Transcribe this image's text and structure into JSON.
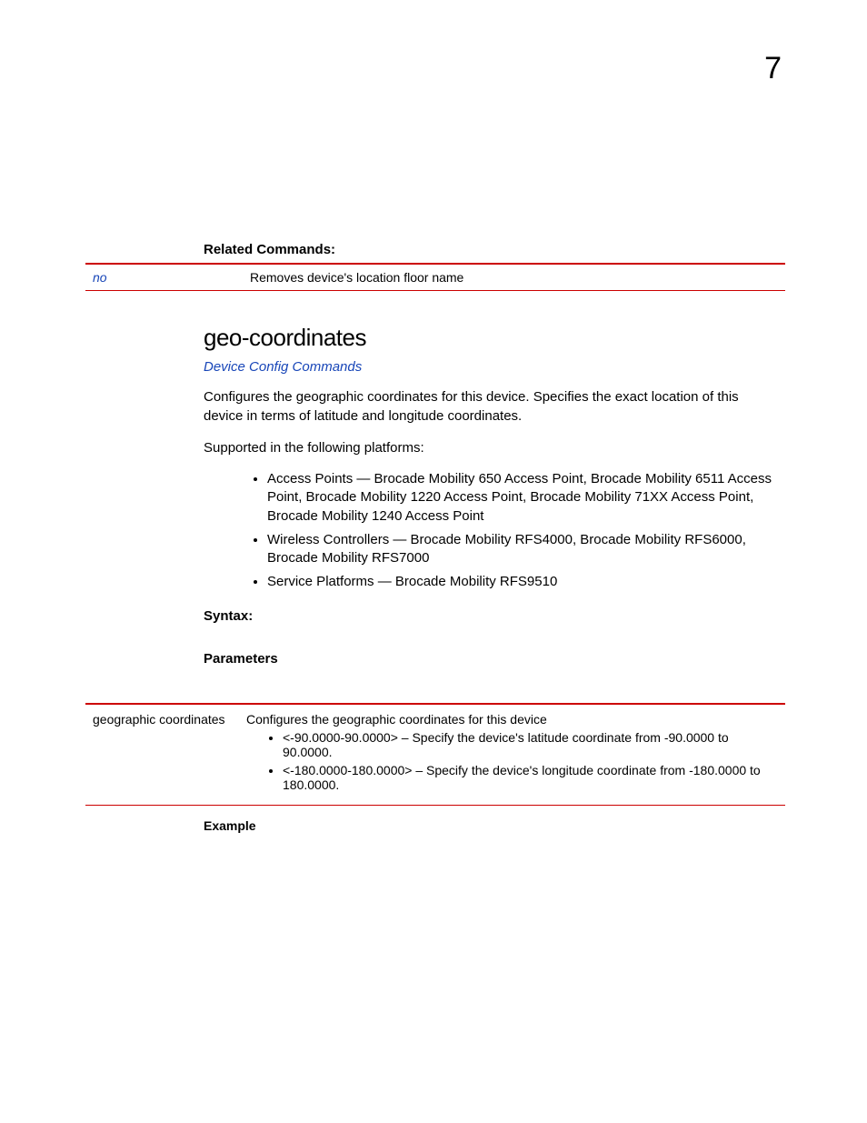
{
  "page_number": "7",
  "related_commands": {
    "label": "Related Commands:",
    "rows": [
      {
        "command": "no",
        "description": "Removes device's location floor name"
      }
    ]
  },
  "section": {
    "heading": "geo-coordinates",
    "breadcrumb_link": "Device Config Commands",
    "intro": "Configures the geographic coordinates for this device. Specifies the exact location of this device in terms of latitude and longitude coordinates.",
    "supported_label": "Supported in the following platforms:",
    "platforms": [
      "Access Points — Brocade Mobility 650 Access Point, Brocade Mobility 6511 Access Point, Brocade Mobility 1220 Access Point, Brocade Mobility 71XX Access Point, Brocade Mobility 1240 Access Point",
      "Wireless Controllers — Brocade Mobility RFS4000, Brocade Mobility RFS6000, Brocade Mobility RFS7000",
      "Service Platforms — Brocade Mobility RFS9510"
    ],
    "syntax_label": "Syntax:",
    "parameters_label": "Parameters",
    "parameters": [
      {
        "name": "geographic coordinates",
        "description": "Configures the geographic coordinates for this device",
        "items": [
          "<-90.0000-90.0000> – Specify the device's latitude coordinate from -90.0000 to 90.0000.",
          "<-180.0000-180.0000> – Specify the device's longitude coordinate from -180.0000 to 180.0000."
        ]
      }
    ],
    "example_label": "Example"
  }
}
